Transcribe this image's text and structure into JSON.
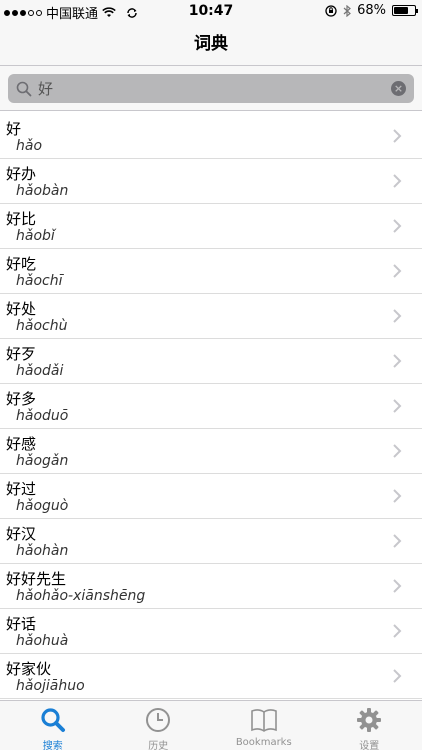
{
  "status_bar": {
    "carrier": "中国联通",
    "time": "10:47",
    "battery": "68%",
    "battery_level": 0.68
  },
  "nav": {
    "title": "词典"
  },
  "search": {
    "value": "好",
    "placeholder": "",
    "clear_icon": "clear-icon"
  },
  "results": [
    {
      "word": "好",
      "pinyin": "hǎo"
    },
    {
      "word": "好办",
      "pinyin": "hǎobàn"
    },
    {
      "word": "好比",
      "pinyin": "hǎobǐ"
    },
    {
      "word": "好吃",
      "pinyin": "hǎochī"
    },
    {
      "word": "好处",
      "pinyin": "hǎochù"
    },
    {
      "word": "好歹",
      "pinyin": "hǎodǎi"
    },
    {
      "word": "好多",
      "pinyin": "hǎoduō"
    },
    {
      "word": "好感",
      "pinyin": "hǎogǎn"
    },
    {
      "word": "好过",
      "pinyin": "hǎoguò"
    },
    {
      "word": "好汉",
      "pinyin": "hǎohàn"
    },
    {
      "word": "好好先生",
      "pinyin": "hǎohǎo-xiānshēng"
    },
    {
      "word": "好话",
      "pinyin": "hǎohuà"
    },
    {
      "word": "好家伙",
      "pinyin": "hǎojiāhuo"
    }
  ],
  "tabs": [
    {
      "label": "搜索",
      "icon": "search-icon",
      "active": true
    },
    {
      "label": "历史",
      "icon": "clock-icon",
      "active": false
    },
    {
      "label": "Bookmarks",
      "icon": "book-icon",
      "active": false
    },
    {
      "label": "设置",
      "icon": "gear-icon",
      "active": false
    }
  ],
  "colors": {
    "accent": "#1a7fd5",
    "inactive": "#929292",
    "search_field": "#b7b7b9"
  }
}
